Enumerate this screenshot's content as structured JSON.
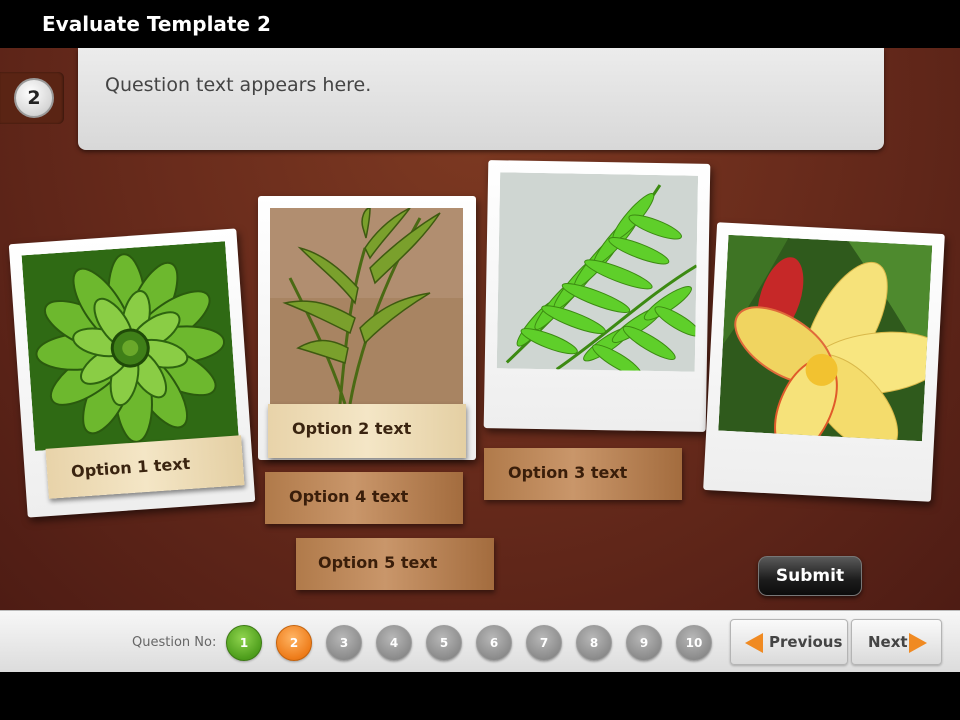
{
  "window": {
    "title": "Evaluate Template 2"
  },
  "question": {
    "number": "2",
    "text": "Question text appears here."
  },
  "options": [
    {
      "label": "Option 1 text"
    },
    {
      "label": "Option 2 text"
    },
    {
      "label": "Option 3 text"
    },
    {
      "label": "Option 4 text"
    },
    {
      "label": "Option 5 text"
    }
  ],
  "images": [
    {
      "icon": "succulent-photo"
    },
    {
      "icon": "palm-shoot-photo"
    },
    {
      "icon": "fern-leaf-photo"
    },
    {
      "icon": "frangipani-flower-photo"
    }
  ],
  "submit_label": "Submit",
  "navigation": {
    "question_no_label": "Question No:",
    "pages": [
      "1",
      "2",
      "3",
      "4",
      "5",
      "6",
      "7",
      "8",
      "9",
      "10"
    ],
    "completed": [
      "1"
    ],
    "current": "2",
    "previous_label": "Previous",
    "next_label": "Next"
  },
  "colors": {
    "completed_dot": "#4e9e1c",
    "current_dot": "#ee7c1a",
    "pending_dot": "#8c8c8c",
    "nav_arrow": "#f08a22"
  }
}
